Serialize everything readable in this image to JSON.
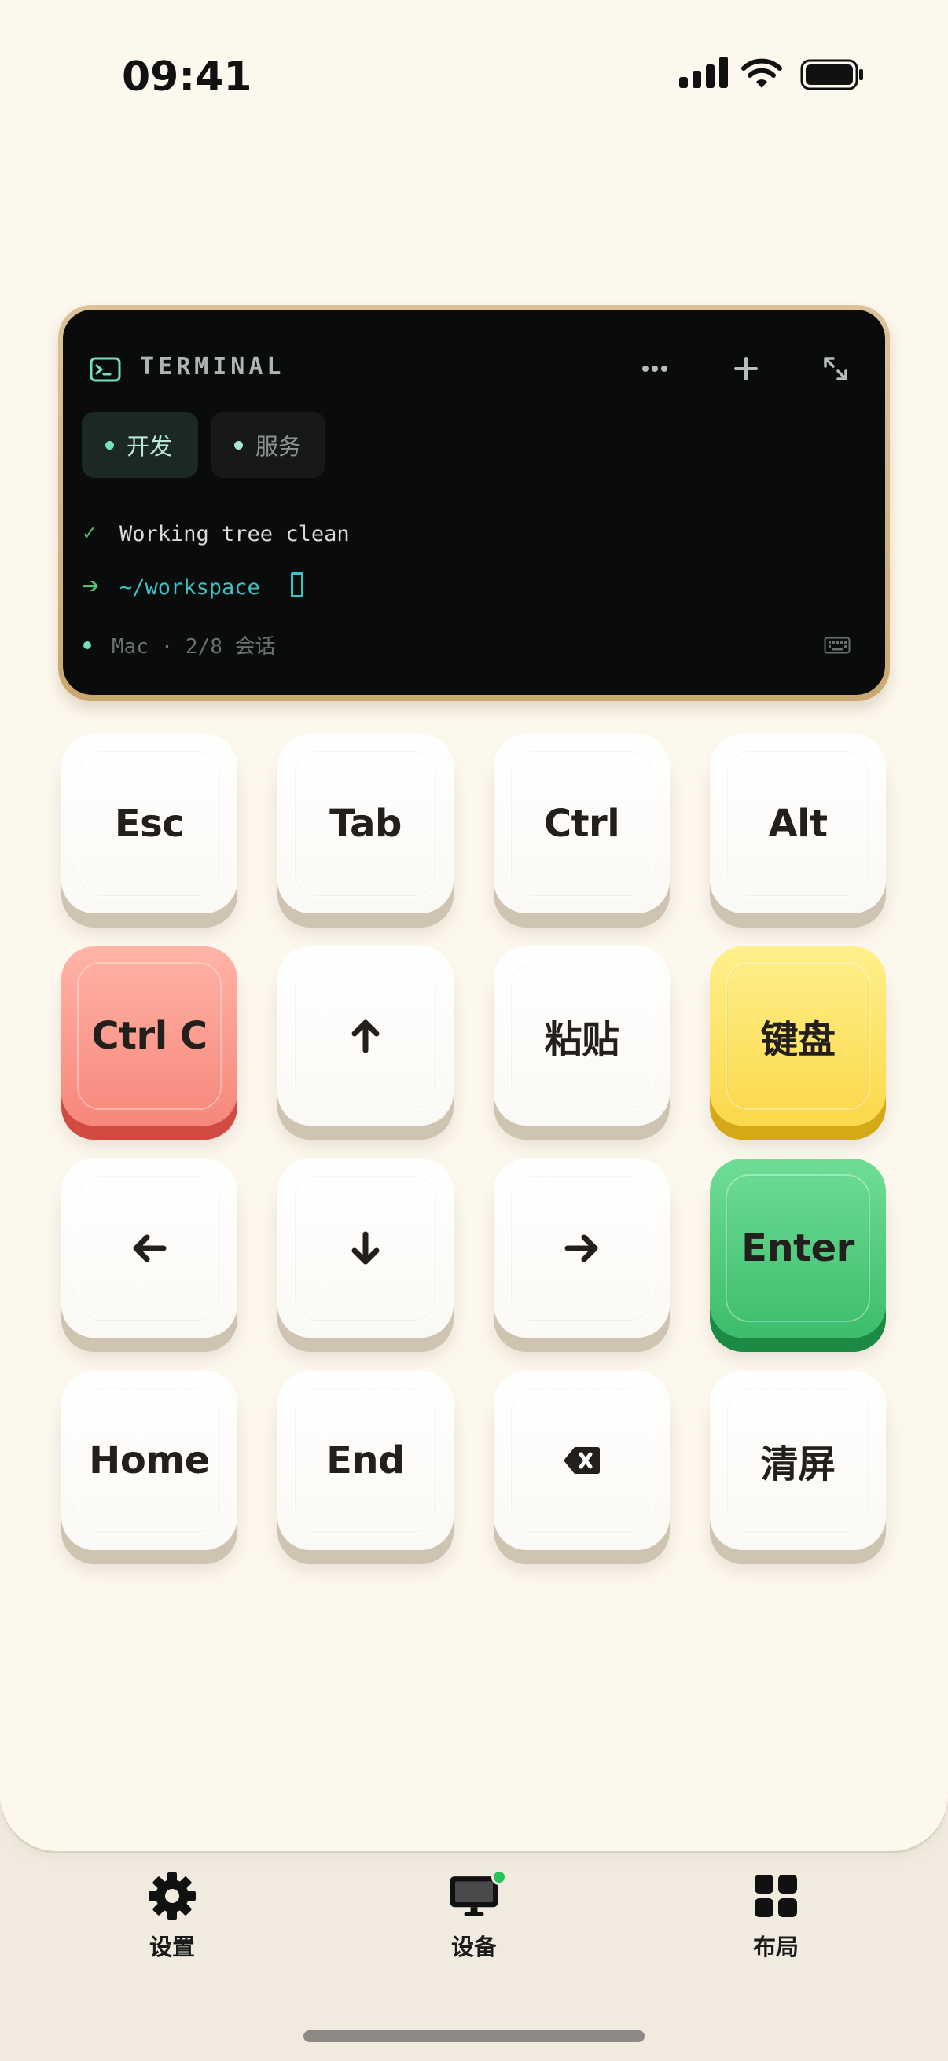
{
  "status_bar": {
    "time": "09:41"
  },
  "terminal": {
    "title": "TERMINAL",
    "actions": {
      "more_icon": "ellipsis-icon",
      "add_icon": "plus-icon",
      "expand_icon": "expand-icon"
    },
    "tabs": [
      {
        "label": "开发",
        "active": true
      },
      {
        "label": "服务",
        "active": false
      }
    ],
    "lines": [
      {
        "marker": "✓",
        "text": "Working tree clean"
      },
      {
        "marker": "➔",
        "text": "~/workspace"
      }
    ],
    "footer": {
      "text": "Mac · 2/8 会话",
      "keyboard_icon": "keyboard-icon"
    },
    "colors": {
      "accent": "#74e1b8",
      "path": "#3ec0c4",
      "frame": "#caa86f"
    }
  },
  "keys": [
    {
      "label": "Esc",
      "color": "white"
    },
    {
      "label": "Tab",
      "color": "white"
    },
    {
      "label": "Ctrl",
      "color": "white"
    },
    {
      "label": "Alt",
      "color": "white"
    },
    {
      "label": "Ctrl C",
      "color": "red"
    },
    {
      "label": "",
      "icon": "arrow-up-icon",
      "color": "white"
    },
    {
      "label": "粘贴",
      "color": "white"
    },
    {
      "label": "键盘",
      "color": "yellow"
    },
    {
      "label": "",
      "icon": "arrow-left-icon",
      "color": "white"
    },
    {
      "label": "",
      "icon": "arrow-down-icon",
      "color": "white"
    },
    {
      "label": "",
      "icon": "arrow-right-icon",
      "color": "white"
    },
    {
      "label": "Enter",
      "color": "green"
    },
    {
      "label": "Home",
      "color": "white"
    },
    {
      "label": "End",
      "color": "white"
    },
    {
      "label": "",
      "icon": "backspace-icon",
      "color": "white"
    },
    {
      "label": "清屏",
      "color": "white"
    }
  ],
  "nav": [
    {
      "label": "设置",
      "icon": "gear-icon"
    },
    {
      "label": "设备",
      "icon": "monitor-icon",
      "status_dot": "#27c25a"
    },
    {
      "label": "布局",
      "icon": "grid-icon"
    }
  ]
}
